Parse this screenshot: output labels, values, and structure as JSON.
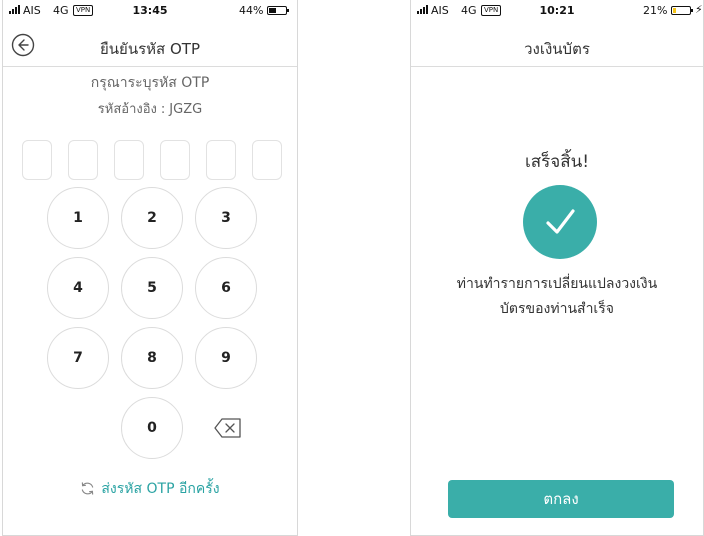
{
  "left_screen": {
    "status": {
      "carrier": "AIS",
      "network": "4G",
      "vpn": "VPN",
      "time": "13:45",
      "battery_pct": "44%",
      "battery_level": 0.44,
      "battery_color": "#111111"
    },
    "header": {
      "title": "ยืนยันรหัส OTP",
      "back_icon": "back-circle-icon"
    },
    "prompt": "กรุณาระบุรหัส OTP",
    "reference": {
      "label": "รหัสอ้างอิง",
      "separator": ":",
      "code": "JGZG"
    },
    "otp_box_count": 6,
    "keypad": {
      "keys": [
        "1",
        "2",
        "3",
        "4",
        "5",
        "6",
        "7",
        "8",
        "9",
        "0"
      ],
      "backspace_icon": "backspace-icon"
    },
    "resend": {
      "icon": "refresh-icon",
      "label": "ส่งรหัส OTP อีกครั้ง"
    }
  },
  "right_screen": {
    "status": {
      "carrier": "AIS",
      "network": "4G",
      "vpn": "VPN",
      "time": "10:21",
      "battery_pct": "21%",
      "battery_level": 0.21,
      "battery_color": "#f5c518"
    },
    "header": {
      "title": "วงเงินบัตร"
    },
    "success_title": "เสร็จสิ้น!",
    "check_icon": "checkmark-icon",
    "message_line1": "ท่านทำรายการเปลี่ยนแปลงวงเงิน",
    "message_line2": "บัตรของท่านสำเร็จ",
    "ok_label": "ตกลง"
  },
  "colors": {
    "accent": "#3aaea9",
    "link": "#2aa3a3"
  }
}
